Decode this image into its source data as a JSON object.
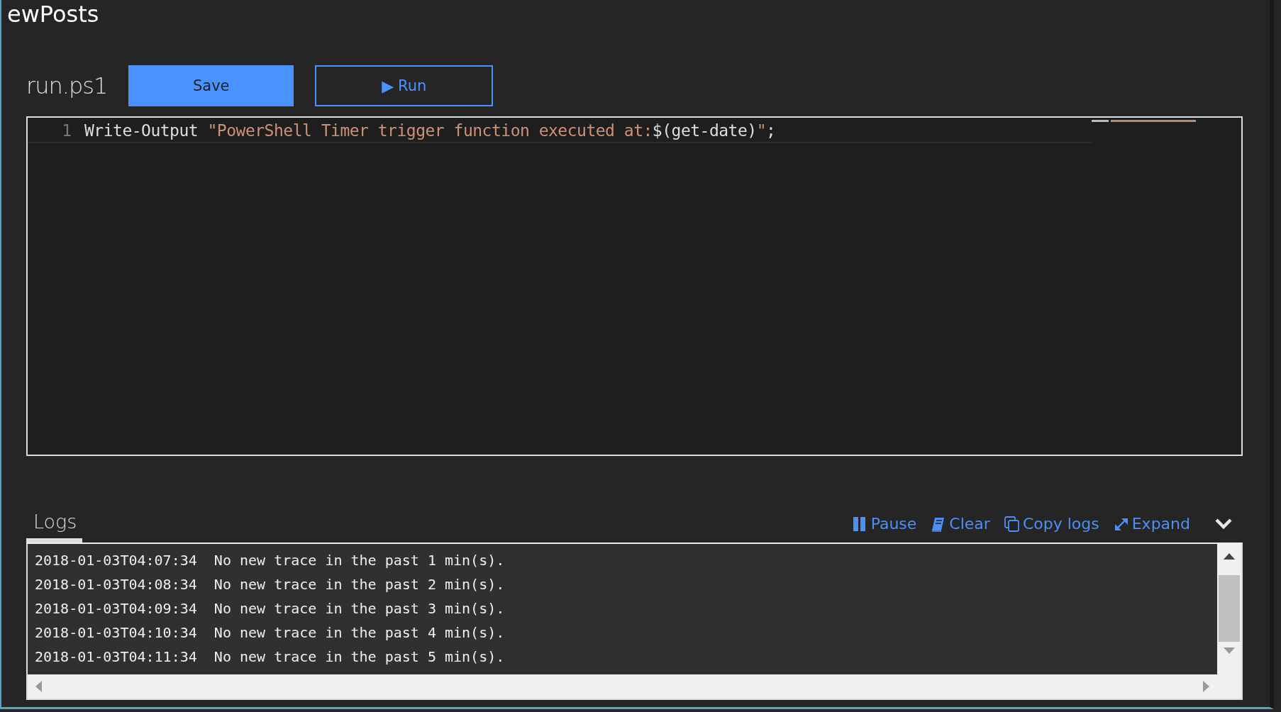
{
  "window": {
    "title": "ewPosts"
  },
  "file": {
    "name": "run.ps1"
  },
  "buttons": [
    {
      "kind": "primary",
      "label": "Save"
    },
    {
      "kind": "outline",
      "label": "Run",
      "icon": "▶"
    }
  ],
  "editor": {
    "lines": [
      {
        "number": "1",
        "tokens": [
          {
            "kind": "plain",
            "text": "Write-Output "
          },
          {
            "kind": "string",
            "text": "\"PowerShell Timer trigger function executed at:"
          },
          {
            "kind": "plain",
            "text": "$(get-date)"
          },
          {
            "kind": "string",
            "text": "\""
          },
          {
            "kind": "plain",
            "text": ";"
          }
        ]
      }
    ]
  },
  "logs": {
    "title": "Logs",
    "actions": [
      {
        "kind": "pause",
        "label": "Pause"
      },
      {
        "kind": "clear",
        "label": "Clear"
      },
      {
        "kind": "copy",
        "label": "Copy logs"
      },
      {
        "kind": "expand",
        "label": "Expand"
      }
    ],
    "lines": [
      {
        "time": "2018-01-03T04:07:34",
        "message": "No new trace in the past 1 min(s)."
      },
      {
        "time": "2018-01-03T04:08:34",
        "message": "No new trace in the past 2 min(s)."
      },
      {
        "time": "2018-01-03T04:09:34",
        "message": "No new trace in the past 3 min(s)."
      },
      {
        "time": "2018-01-03T04:10:34",
        "message": "No new trace in the past 4 min(s)."
      },
      {
        "time": "2018-01-03T04:11:34",
        "message": "No new trace in the past 5 min(s)."
      }
    ]
  }
}
